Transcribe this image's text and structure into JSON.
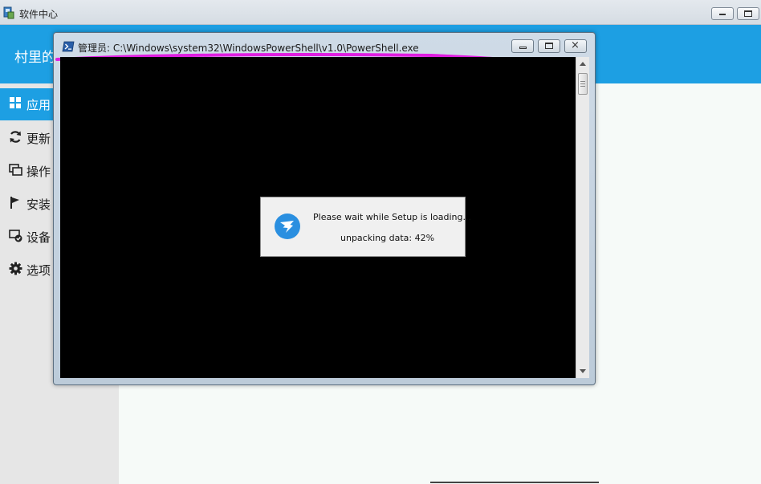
{
  "app": {
    "title": "软件中心",
    "header_title": "村里的",
    "brand_color": "#1d9fe3",
    "icon": "software-center-icon"
  },
  "sidebar": {
    "items": [
      {
        "label": "应用",
        "icon": "grid-icon",
        "active": true
      },
      {
        "label": "更新",
        "icon": "refresh-icon",
        "active": false
      },
      {
        "label": "操作",
        "icon": "windows-stack-icon",
        "active": false
      },
      {
        "label": "安装",
        "icon": "flag-icon",
        "active": false
      },
      {
        "label": "设备",
        "icon": "device-check-icon",
        "active": false
      },
      {
        "label": "选项",
        "icon": "gear-icon",
        "active": false
      }
    ]
  },
  "powershell": {
    "title": "管理员: C:\\Windows\\system32\\WindowsPowerShell\\v1.0\\PowerShell.exe",
    "icon": "powershell-icon",
    "annotation_color": "#e01ee0"
  },
  "setup_dialog": {
    "message": "Please wait while Setup is loading...",
    "progress_text": "unpacking data: 42%",
    "progress_percent": 42,
    "icon": "dingtalk-logo-icon"
  }
}
